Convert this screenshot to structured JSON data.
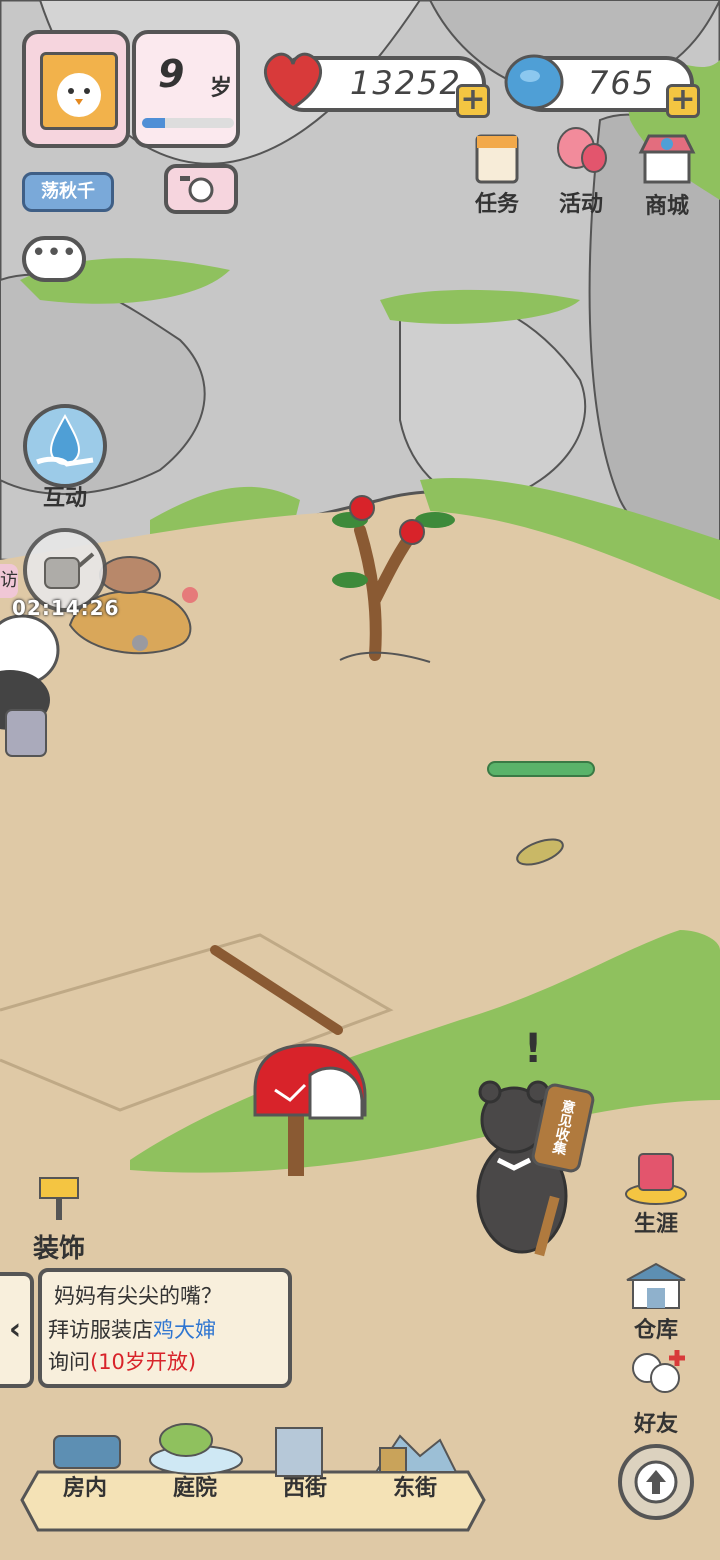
{
  "profile": {
    "age_number": "9",
    "age_unit": "岁",
    "age_progress": 0.25
  },
  "swing_button": "荡秋千",
  "resources": {
    "hearts": "13252",
    "gems": "765"
  },
  "top_menu": [
    {
      "label": "任务",
      "icon": "task-clipboard-icon"
    },
    {
      "label": "活动",
      "icon": "balloon-icon"
    },
    {
      "label": "商城",
      "icon": "shop-icon"
    }
  ],
  "left_actions": {
    "interact_label": "互动",
    "watering_timer": "02:14:26",
    "visit_tab": "访"
  },
  "sign_text": "意见收集",
  "decor_label": "装饰",
  "quest": {
    "title": "妈妈有尖尖的嘴？",
    "line1_prefix": "拜访服装店",
    "line1_highlight": "鸡大婶",
    "line2_prefix": "询问",
    "line2_note": "(10岁开放)"
  },
  "side_menu": [
    {
      "label": "生涯",
      "icon": "career-book-icon"
    },
    {
      "label": "仓库",
      "icon": "warehouse-icon"
    },
    {
      "label": "好友",
      "icon": "friends-icon"
    }
  ],
  "bottom_nav": [
    {
      "label": "房内"
    },
    {
      "label": "庭院"
    },
    {
      "label": "西街"
    },
    {
      "label": "东街"
    }
  ],
  "colors": {
    "ground": "#dfc9a6",
    "rock": "#c9c9c9",
    "grass": "#8fc15e",
    "accent_red": "#d8232a",
    "accent_blue": "#2f76d1"
  }
}
